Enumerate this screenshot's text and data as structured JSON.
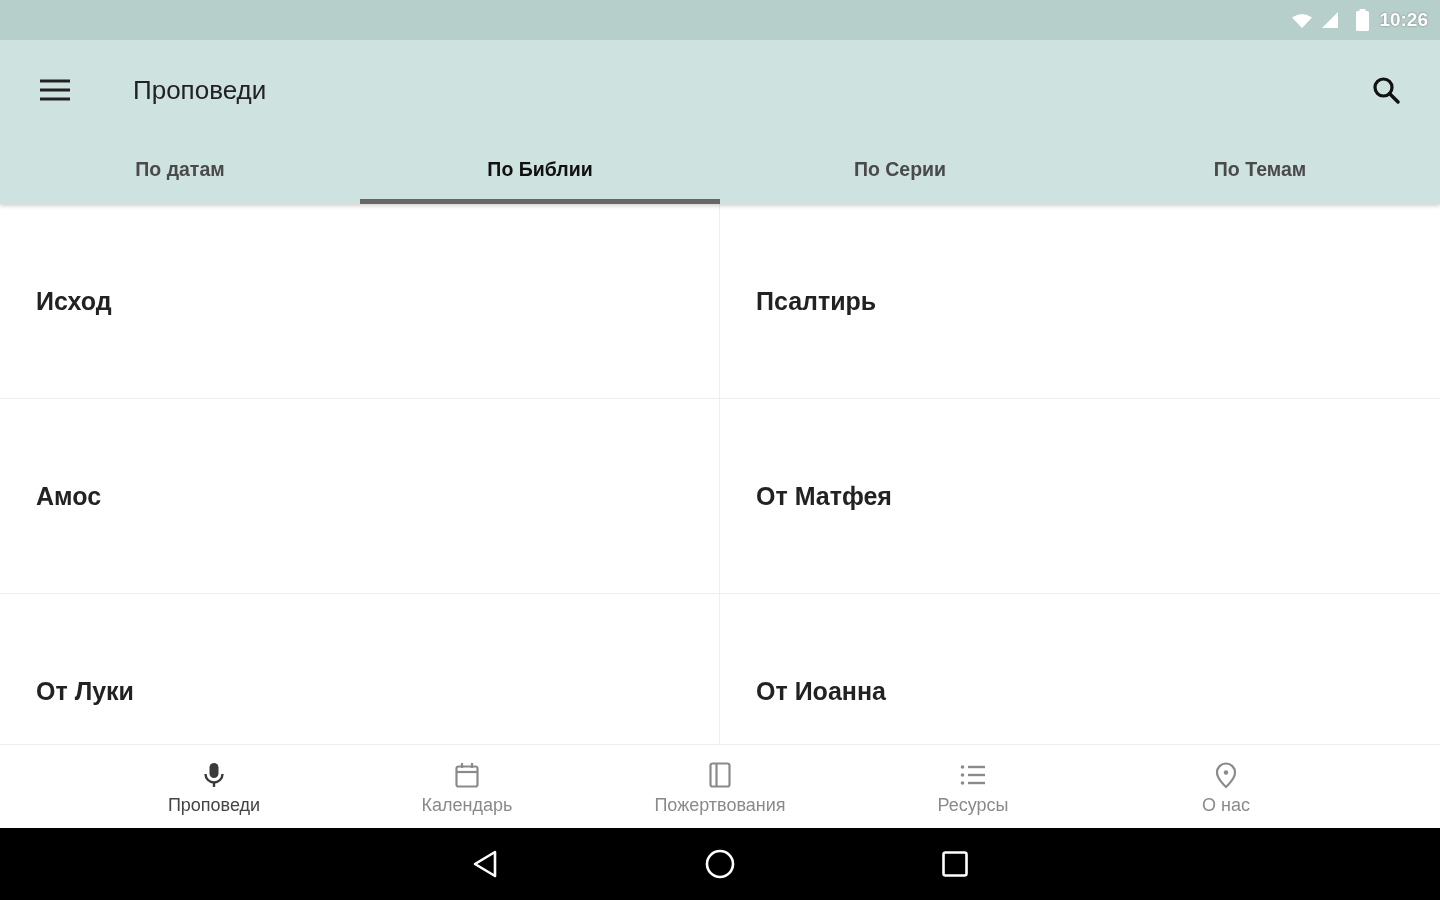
{
  "status_bar": {
    "time": "10:26"
  },
  "app_bar": {
    "title": "Проповеди"
  },
  "tabs": [
    {
      "label": "По датам",
      "selected": false
    },
    {
      "label": "По Библии",
      "selected": true
    },
    {
      "label": "По Серии",
      "selected": false
    },
    {
      "label": "По Темам",
      "selected": false
    }
  ],
  "books": [
    {
      "name": "Исход"
    },
    {
      "name": "Псалтирь"
    },
    {
      "name": "Амос"
    },
    {
      "name": "От Матфея"
    },
    {
      "name": "От Луки"
    },
    {
      "name": "От Иоанна"
    }
  ],
  "bottom_nav": [
    {
      "label": "Проповеди",
      "selected": true
    },
    {
      "label": "Календарь",
      "selected": false
    },
    {
      "label": "Пожертвования",
      "selected": false
    },
    {
      "label": "Ресурсы",
      "selected": false
    },
    {
      "label": "О нас",
      "selected": false
    }
  ]
}
